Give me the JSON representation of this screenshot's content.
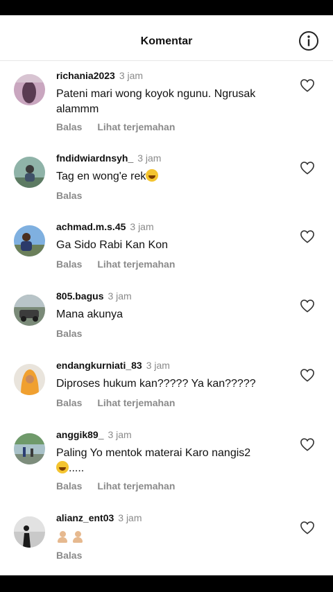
{
  "header": {
    "title": "Komentar",
    "info_icon": "info-circle-icon"
  },
  "comments": [
    {
      "username": "richania2023",
      "time": "3 jam",
      "text": "Pateni mari wong koyok ngunu. Ngrusak alammm",
      "actions": [
        "Balas",
        "Lihat terjemahan"
      ]
    },
    {
      "username": "fndidwiardnsyh_",
      "time": "3 jam",
      "text": "Tag en wong'e rek",
      "emoji": "laughing-emoji",
      "actions": [
        "Balas"
      ]
    },
    {
      "username": "achmad.m.s.45",
      "time": "3 jam",
      "text": "Ga Sido Rabi Kan Kon",
      "actions": [
        "Balas",
        "Lihat terjemahan"
      ]
    },
    {
      "username": "805.bagus",
      "time": "3 jam",
      "text": "Mana akunya",
      "actions": [
        "Balas"
      ]
    },
    {
      "username": "endangkurniati_83",
      "time": "3 jam",
      "text": "Diproses hukum kan????? Ya kan?????",
      "actions": [
        "Balas",
        "Lihat terjemahan"
      ]
    },
    {
      "username": "anggik89_",
      "time": "3 jam",
      "text_line1": "Paling Yo mentok materai Karo nangis2",
      "text_line2": ".....",
      "emoji": "laughing-emoji",
      "actions": [
        "Balas",
        "Lihat terjemahan"
      ]
    },
    {
      "username": "alianz_ent03",
      "time": "3 jam",
      "emoji": "people-emoji",
      "actions": [
        "Balas"
      ]
    }
  ],
  "heart_icon": "heart-outline-icon",
  "colors": {
    "muted": "#8a8a8a",
    "text": "#111111",
    "divider": "#e6e6e6"
  }
}
